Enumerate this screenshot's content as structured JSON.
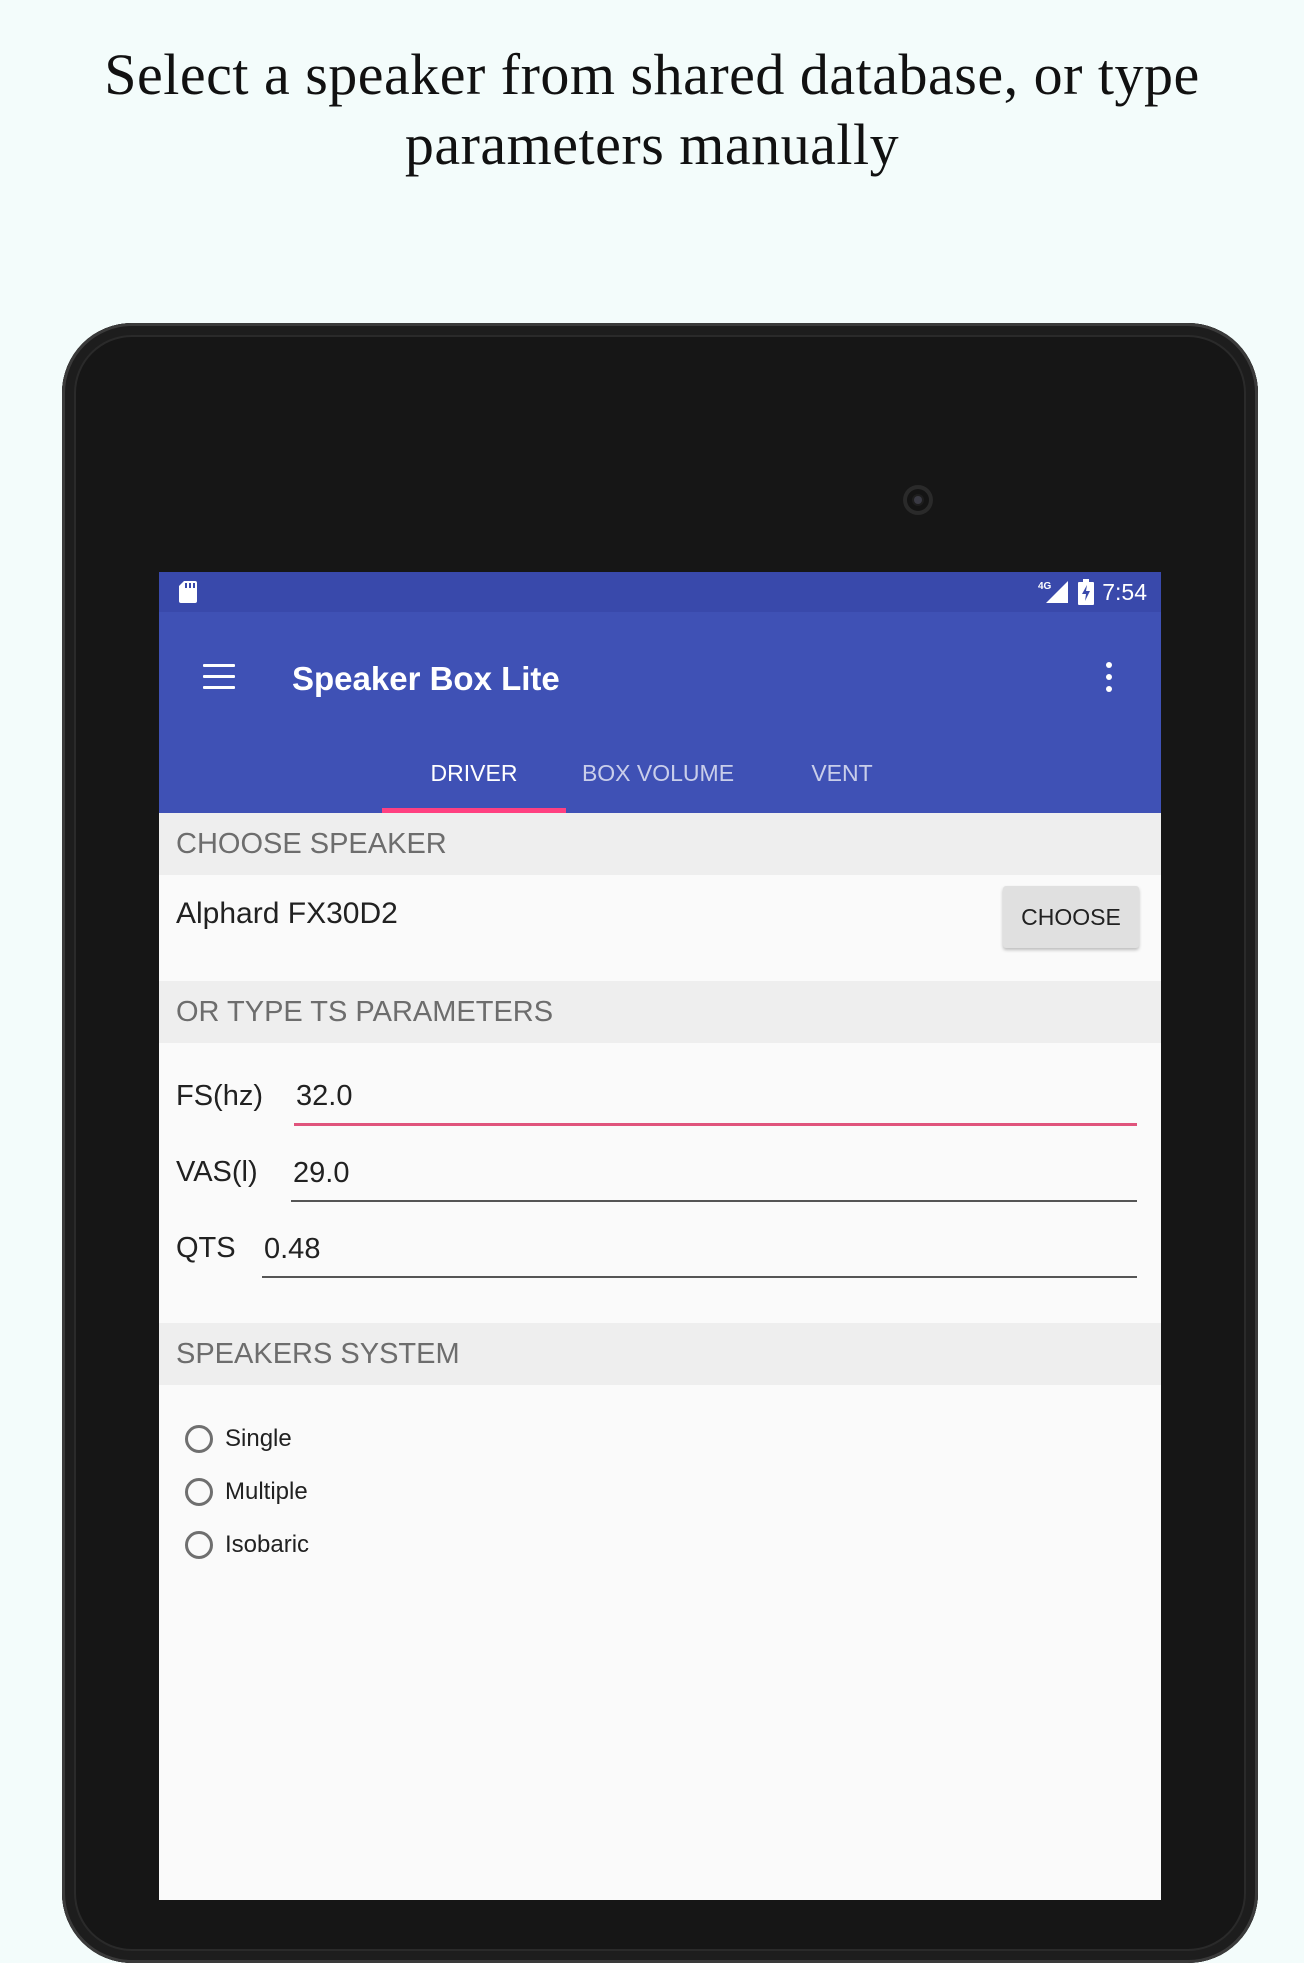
{
  "headline": {
    "line1": "Select a speaker from shared database, or type",
    "line2": "parameters manually"
  },
  "status_bar": {
    "left_icon": "sd-card-icon",
    "network_label": "4G",
    "signal_icon": "signal-icon",
    "battery_icon": "battery-charging-icon",
    "time": "7:54"
  },
  "app_bar": {
    "menu_icon": "hamburger-menu-icon",
    "title": "Speaker Box Lite",
    "overflow_icon": "more-vert-icon"
  },
  "tabs": [
    {
      "label": "DRIVER",
      "active": true
    },
    {
      "label": "BOX VOLUME",
      "active": false
    },
    {
      "label": "VENT",
      "active": false
    }
  ],
  "choose_speaker": {
    "header": "CHOOSE SPEAKER",
    "selected_speaker": "Alphard FX30D2",
    "button_label": "CHOOSE"
  },
  "ts_parameters": {
    "header": "OR TYPE TS PARAMETERS",
    "fields": [
      {
        "label": "FS(hz)",
        "value": "32.0",
        "focused": true
      },
      {
        "label": "VAS(l)",
        "value": "29.0",
        "focused": false
      },
      {
        "label": "QTS",
        "value": "0.48",
        "focused": false
      }
    ]
  },
  "speakers_system": {
    "header": "SPEAKERS SYSTEM",
    "options": [
      {
        "label": "Single",
        "checked": false
      },
      {
        "label": "Multiple",
        "checked": false
      },
      {
        "label": "Isobaric",
        "checked": false
      }
    ]
  },
  "colors": {
    "status_bar": "#3949ab",
    "app_bar": "#3f51b5",
    "accent": "#ff4081",
    "section_header_bg": "#eeeeee",
    "background": "#f3fcfb"
  }
}
